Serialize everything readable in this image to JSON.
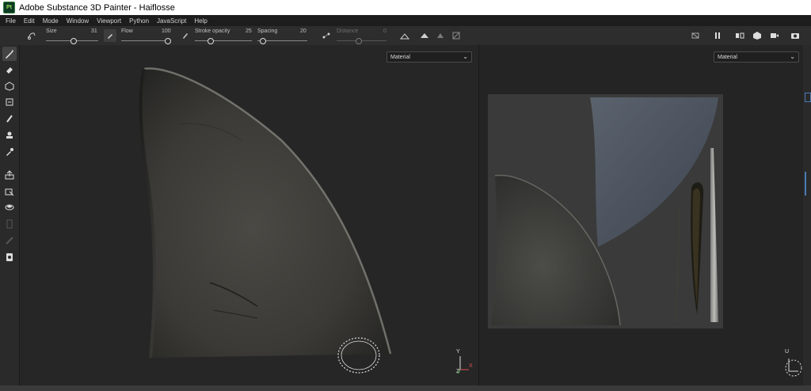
{
  "window": {
    "title": "Adobe Substance 3D Painter - Haiflosse",
    "logo_text": "Pt"
  },
  "menu": [
    "File",
    "Edit",
    "Mode",
    "Window",
    "Viewport",
    "Python",
    "JavaScript",
    "Help"
  ],
  "toolbar": {
    "size": {
      "label": "Size",
      "value": "31"
    },
    "flow": {
      "label": "Flow",
      "value": "100"
    },
    "stroke_opacity": {
      "label": "Stroke opacity",
      "value": "25"
    },
    "spacing": {
      "label": "Spacing",
      "value": "20"
    },
    "distance": {
      "label": "Distance",
      "value": "0"
    }
  },
  "viewport3d": {
    "mode": "Material"
  },
  "viewport2d": {
    "mode": "Material"
  },
  "axes": {
    "y": "Y",
    "x": "X",
    "z": "Z",
    "u": "U"
  }
}
